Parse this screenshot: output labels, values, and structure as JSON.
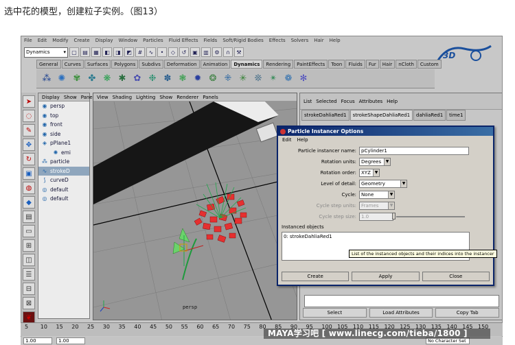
{
  "caption": "选中花的模型，创建粒子实例。（图13）",
  "menubar": [
    "File",
    "Edit",
    "Modify",
    "Create",
    "Display",
    "Window",
    "Particles",
    "Fluid Effects",
    "Fields",
    "Soft/Rigid Bodies",
    "Effects",
    "Solvers",
    "Hair",
    "Help"
  ],
  "mode_menu": "Dynamics",
  "shelf_tabs": [
    "General",
    "Curves",
    "Surfaces",
    "Polygons",
    "Subdivs",
    "Deformation",
    "Animation",
    "Dynamics",
    "Rendering",
    "PaintEffects",
    "Toon",
    "Fluids",
    "Fur",
    "Hair",
    "nCloth",
    "Custom"
  ],
  "active_shelf_tab": "Dynamics",
  "outliner": {
    "menu": [
      "Display",
      "Show",
      "Panel"
    ],
    "items": [
      {
        "label": "persp",
        "icon": "camera-icon"
      },
      {
        "label": "top",
        "icon": "camera-icon"
      },
      {
        "label": "front",
        "icon": "camera-icon"
      },
      {
        "label": "side",
        "icon": "camera-icon"
      },
      {
        "label": "pPlane1",
        "icon": "mesh-icon"
      },
      {
        "label": "emi",
        "icon": "emitter-icon"
      },
      {
        "label": "particle",
        "icon": "particle-icon"
      },
      {
        "label": "strokeD",
        "icon": "stroke-icon"
      },
      {
        "label": "curveD",
        "icon": "curve-icon"
      },
      {
        "label": "default",
        "icon": "light-icon"
      },
      {
        "label": "default",
        "icon": "light-icon"
      }
    ]
  },
  "viewport": {
    "menu": [
      "View",
      "Shading",
      "Lighting",
      "Show",
      "Renderer",
      "Panels"
    ],
    "camera_label": "persp"
  },
  "attribute_editor": {
    "menu": [
      "List",
      "Selected",
      "Focus",
      "Attributes",
      "Help"
    ],
    "tabs": [
      "strokeDahliaRed1",
      "strokeShapeDahliaRed1",
      "dahliaRed1",
      "time1"
    ],
    "buttons": [
      "Select",
      "Load Attributes",
      "Copy Tab"
    ]
  },
  "dialog": {
    "title": "Particle Instancer Options",
    "menu": [
      "Edit",
      "Help"
    ],
    "fields": {
      "name_label": "Particle instancer name:",
      "name_value": "pCylinder1",
      "rot_units_label": "Rotation units:",
      "rot_units_value": "Degrees",
      "rot_order_label": "Rotation order:",
      "rot_order_value": "XYZ",
      "lod_label": "Level of detail:",
      "lod_value": "Geometry",
      "cycle_label": "Cycle:",
      "cycle_value": "None",
      "cycle_units_label": "Cycle step units:",
      "cycle_units_value": "Frames",
      "cycle_size_label": "Cycle step size:",
      "cycle_size_value": "1.0"
    },
    "instanced_label": "Instanced objects",
    "instanced_items": [
      "0: strokeDahliaRed1"
    ],
    "tooltip": "List of the instanced objects and their indices into the instancer",
    "buttons": [
      "Create",
      "Apply",
      "Close"
    ]
  },
  "timeline": {
    "ticks": [
      "5",
      "10",
      "15",
      "20",
      "25",
      "30",
      "35",
      "40",
      "45",
      "50",
      "55",
      "60",
      "65",
      "70",
      "75",
      "80",
      "85",
      "90",
      "95",
      "100",
      "105",
      "110",
      "115",
      "120",
      "125",
      "130",
      "135",
      "140",
      "145",
      "150"
    ],
    "start": "1.00",
    "current": "1.00",
    "char_set": "No Character Set"
  },
  "watermark": "MAYA学习吧 [ www.linecg.com/tieba/1800 ]"
}
